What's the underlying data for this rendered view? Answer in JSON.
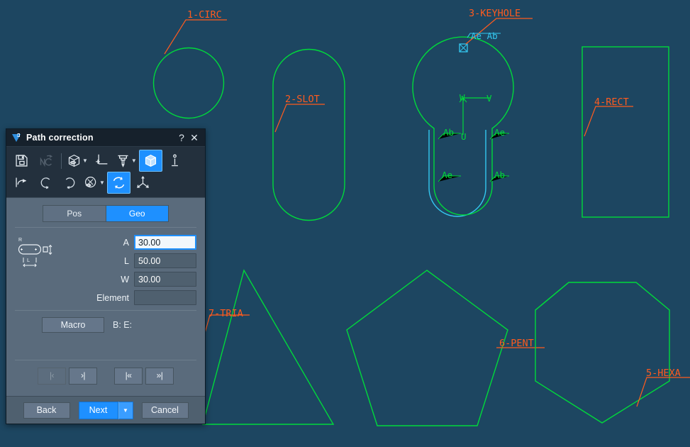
{
  "canvas": {
    "background_color": "#1d4661",
    "geometry_color": "#00d93b",
    "offset_path_color": "#34c8f0",
    "label_color": "#ff5b1e",
    "marker_label_color": "#00d93b",
    "shapes": [
      {
        "id": "1-CIRC",
        "label": "1-CIRC",
        "type": "circle"
      },
      {
        "id": "2-SLOT",
        "label": "2-SLOT",
        "type": "slot"
      },
      {
        "id": "3-KEYHOLE",
        "label": "3-KEYHOLE",
        "type": "keyhole"
      },
      {
        "id": "4-RECT",
        "label": "4-RECT",
        "type": "rectangle"
      },
      {
        "id": "5-HEXA",
        "label": "5-HEXA",
        "type": "hexagon"
      },
      {
        "id": "6-PENT",
        "label": "6-PENT",
        "type": "pentagon"
      },
      {
        "id": "7-TRIA",
        "label": "7-TRIA",
        "type": "triangle"
      }
    ],
    "keyhole_markers": {
      "start_end_top": "Ae  Ab",
      "upper_left": "Ab",
      "upper_right": "Ae",
      "lower_left": "Ae",
      "lower_right": "Ab"
    },
    "axis_labels": {
      "w": "W",
      "v": "V",
      "u": "U"
    }
  },
  "dialog": {
    "title": "Path correction",
    "title_icon": "app-logo-icon",
    "help_label": "?",
    "close_label": "✕",
    "toolbar": {
      "row1": [
        {
          "name": "save-button",
          "icon": "floppy-disk-icon",
          "state": "normal",
          "dropdown": false
        },
        {
          "name": "nc-output-button",
          "icon": "nc-arrow-icon",
          "state": "disabled",
          "dropdown": false
        },
        {
          "name": "view-workpiece-button",
          "icon": "cube-eye-icon",
          "state": "normal",
          "dropdown": true
        },
        {
          "name": "origin-button",
          "icon": "axis-origin-icon",
          "state": "normal",
          "dropdown": false
        },
        {
          "name": "tool-button",
          "icon": "milling-tool-icon",
          "state": "normal",
          "dropdown": true
        },
        {
          "name": "solid-view-button",
          "icon": "solid-cube-icon",
          "state": "active",
          "dropdown": false
        },
        {
          "name": "info-button",
          "icon": "info-pillar-icon",
          "state": "normal",
          "dropdown": false
        }
      ],
      "row2": [
        {
          "name": "undo-path-button",
          "icon": "undo-hook-icon",
          "state": "normal",
          "dropdown": false
        },
        {
          "name": "rotate-ccw-button",
          "icon": "rotate-ccw-icon",
          "state": "normal",
          "dropdown": false
        },
        {
          "name": "rotate-cw-button",
          "icon": "rotate-cw-icon",
          "state": "normal",
          "dropdown": false
        },
        {
          "name": "cut-preview-button",
          "icon": "scissors-eye-icon",
          "state": "normal",
          "dropdown": true
        },
        {
          "name": "refresh-button",
          "icon": "refresh-cycle-icon",
          "state": "active",
          "dropdown": false
        },
        {
          "name": "coordinate-axes-button",
          "icon": "coordinate-axes-icon",
          "state": "normal",
          "dropdown": false
        }
      ]
    },
    "tabs": [
      {
        "name": "tab-pos",
        "label": "Pos",
        "selected": false
      },
      {
        "name": "tab-geo",
        "label": "Geo",
        "selected": true
      }
    ],
    "geo_thumb": {
      "icon": "slot-dimension-icon",
      "annotations": {
        "radius": "R",
        "length": "L",
        "width": "W"
      }
    },
    "fields": [
      {
        "name": "field-a",
        "label": "A",
        "value": "30.00",
        "placeholder": "",
        "focused": true
      },
      {
        "name": "field-l",
        "label": "L",
        "value": "50.00",
        "placeholder": "",
        "focused": false
      },
      {
        "name": "field-w",
        "label": "W",
        "value": "30.00",
        "placeholder": "",
        "focused": false
      },
      {
        "name": "field-element",
        "label": "Element",
        "value": "",
        "placeholder": "",
        "focused": false
      }
    ],
    "macro": {
      "label": "Macro",
      "be_text": "B: E:"
    },
    "nav": [
      {
        "name": "nav-first-element",
        "label": "|‹",
        "disabled": true
      },
      {
        "name": "nav-next-element",
        "label": "›|",
        "disabled": false
      },
      {
        "name": "nav-first-group",
        "label": "|«",
        "disabled": false
      },
      {
        "name": "nav-last-group",
        "label": "»|",
        "disabled": false
      }
    ],
    "footer": {
      "back_label": "Back",
      "next_label": "Next",
      "next_dropdown_icon": "chevron-down-icon",
      "cancel_label": "Cancel"
    }
  }
}
